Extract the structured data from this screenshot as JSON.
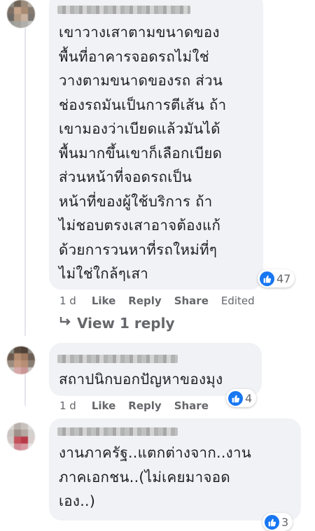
{
  "comments": [
    {
      "text": "เขาวางเสาตามขนาดของ\nพื้นที่อาคารจอดรถไม่ใช่\nวางตามขนาดของรถ ส่วน\nช่องรถมันเป็นการตีเส้น ถ้า\nเขามองว่าเบียดแล้วมันได้\nพื้นมากขึ้นเขาก็เลือกเบียด\nส่วนหน้าที่จอดรถเป็น\nหน้าที่ของผู้ใช้บริการ ถ้า\nไม่ชอบตรงเสาอาจต้องแก้\nด้วยการวนหาที่รถใหม่ที่ๆ\nไม่ใช่ใกล้ๆเสา",
      "reaction_count": "47",
      "time": "1 d",
      "like_label": "Like",
      "reply_label": "Reply",
      "share_label": "Share",
      "edited_label": "Edited",
      "view_replies": "View 1 reply"
    },
    {
      "text": "สถาปนิกบอกปัญหาของมุง",
      "reaction_count": "4",
      "time": "1 d",
      "like_label": "Like",
      "reply_label": "Reply",
      "share_label": "Share"
    },
    {
      "text": "งานภาครัฐ..แตกต่างจาก..งาน\nภาคเอกชน..(ไม่เคยมาจอด\nเอง..)",
      "reaction_count": "3"
    }
  ],
  "colors": {
    "bubble": "#f0f2f5",
    "meta_text": "#65676b",
    "like_blue": "#1877f2"
  },
  "icons": [
    "like-icon",
    "reply-arrow-icon"
  ]
}
